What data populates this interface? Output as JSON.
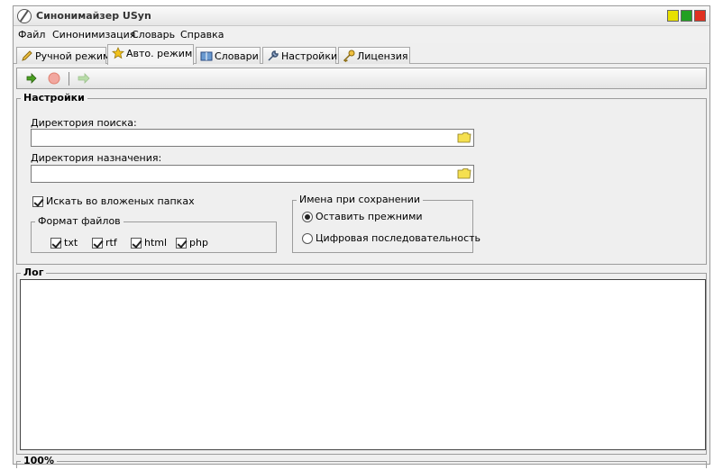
{
  "window": {
    "title": "Синонимайзер USyn"
  },
  "menu": [
    "Файл",
    "Синонимизация",
    "Словарь",
    "Справка"
  ],
  "tabs": [
    {
      "label": "Ручной режим",
      "active": false
    },
    {
      "label": "Авто. режим",
      "active": true
    },
    {
      "label": "Словари",
      "active": false
    },
    {
      "label": "Настройки",
      "active": false
    },
    {
      "label": "Лицензия",
      "active": false
    }
  ],
  "toolbar": {
    "start_icon": "green-arrow-icon",
    "stop_icon": "stop-icon",
    "next_icon": "next-arrow-icon"
  },
  "settings": {
    "legend": "Настройки",
    "search_dir": {
      "label": "Директория поиска:",
      "value": ""
    },
    "dest_dir": {
      "label": "Директория назначения:",
      "value": ""
    },
    "search_subfolders": {
      "label": "Искать во вложеных папках",
      "checked": true
    },
    "formats": {
      "legend": "Формат файлов",
      "items": [
        {
          "label": "txt",
          "checked": true
        },
        {
          "label": "rtf",
          "checked": true
        },
        {
          "label": "html",
          "checked": true
        },
        {
          "label": "php",
          "checked": true
        }
      ]
    },
    "naming": {
      "legend": "Имена при сохранении",
      "options": [
        {
          "label": "Оставить прежними",
          "selected": true
        },
        {
          "label": "Цифровая последовательность",
          "selected": false
        }
      ]
    }
  },
  "log": {
    "legend": "Лог",
    "content": ""
  },
  "status": {
    "progress": "100%"
  }
}
